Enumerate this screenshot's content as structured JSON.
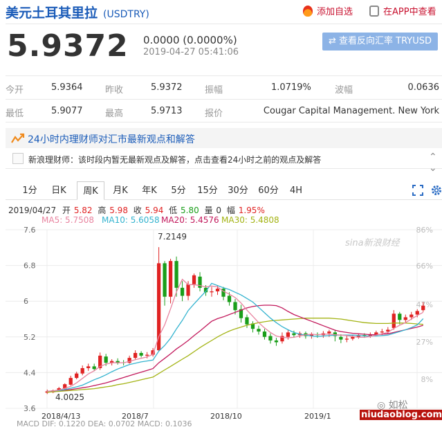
{
  "header": {
    "title": "美元土耳其里拉",
    "code": "(USDTRY)",
    "add_watch": "添加自选",
    "view_in_app": "在APP中查看"
  },
  "quote": {
    "price": "5.9372",
    "change": "0.0000 (0.0000%)",
    "time": "2019-04-27 05:41:06",
    "reverse_btn": "⇄ 查看反向汇率 TRYUSD"
  },
  "stats": [
    [
      {
        "label": "今开",
        "value": "5.9364"
      },
      {
        "label": "昨收",
        "value": "5.9372"
      },
      {
        "label": "振幅",
        "value": "1.0719%"
      },
      {
        "label": "波幅",
        "value": "0.0636"
      }
    ],
    [
      {
        "label": "最低",
        "value": "5.9077"
      },
      {
        "label": "最高",
        "value": "5.9713"
      },
      {
        "label": "报价",
        "value": "Cougar Capital Management. New York"
      }
    ]
  ],
  "expert": {
    "title": "24小时内理财师对汇市最新观点和解答",
    "note": "新浪理财师：该时段内暂无最新观点及解答，点击查看24小时之前的观点及解答"
  },
  "tabs": [
    "1分",
    "日K",
    "周K",
    "月K",
    "年K",
    "5分",
    "15分",
    "30分",
    "60分",
    "4H"
  ],
  "active_tab": "周K",
  "ohlc": {
    "date": "2019/04/27",
    "open_label": "开",
    "open": "5.82",
    "high_label": "高",
    "high": "5.98",
    "close_label": "收",
    "close": "5.94",
    "low_label": "低",
    "low": "5.80",
    "volume_label": "量",
    "volume": "0",
    "amp_label": "幅",
    "amp": "1.95%"
  },
  "ma_legend": [
    {
      "text": "MA5: 5.7508",
      "color": "#e8839f"
    },
    {
      "text": "MA10: 5.6058",
      "color": "#33b3cf"
    },
    {
      "text": "MA20: 5.4576",
      "color": "#c2185b"
    },
    {
      "text": "MA30: 5.4808",
      "color": "#a3b313"
    }
  ],
  "watermark": "sina新浪财经",
  "wechat": "◎ 如松",
  "site": "niudaoblog.com",
  "macd": "MACD   DIF: 0.1220          DEA: 0.0702         MACD: 0.1036",
  "colors": {
    "up": "#e02222",
    "down": "#1a9e1a",
    "ma5": "#e8839f",
    "ma10": "#33b3cf",
    "ma20": "#c2185b",
    "ma30": "#a3b313"
  },
  "chart_data": {
    "type": "candlestick",
    "x_ticks": [
      "2018/4/13",
      "2018/7",
      "2018/10",
      "2019/1",
      "2019/4/27"
    ],
    "y_ticks": [
      "7.6",
      "6.8",
      "6",
      "5.2",
      "4.4",
      "3.6"
    ],
    "pct_ticks": [
      "86%",
      "66%",
      "47%",
      "27%",
      "8%"
    ],
    "ylim": [
      3.6,
      7.6
    ],
    "max_label": "7.2149",
    "min_label": "4.0025",
    "candles": [
      [
        3.95,
        3.98,
        3.92,
        4.02
      ],
      [
        3.96,
        4.0,
        3.94,
        4.02
      ],
      [
        4.0,
        4.05,
        3.99,
        4.08
      ],
      [
        4.04,
        4.14,
        4.02,
        4.16
      ],
      [
        4.13,
        4.28,
        4.11,
        4.33
      ],
      [
        4.28,
        4.38,
        4.25,
        4.42
      ],
      [
        4.38,
        4.5,
        4.34,
        4.56
      ],
      [
        4.5,
        4.54,
        4.44,
        4.6
      ],
      [
        4.54,
        4.48,
        4.44,
        4.6
      ],
      [
        4.5,
        4.78,
        4.46,
        4.85
      ],
      [
        4.76,
        4.62,
        4.55,
        4.82
      ],
      [
        4.62,
        4.66,
        4.56,
        4.7
      ],
      [
        4.66,
        4.62,
        4.58,
        4.72
      ],
      [
        4.63,
        4.62,
        4.56,
        4.68
      ],
      [
        4.62,
        4.73,
        4.6,
        4.78
      ],
      [
        4.73,
        4.84,
        4.7,
        4.9
      ],
      [
        4.84,
        4.78,
        4.74,
        4.88
      ],
      [
        4.78,
        4.8,
        4.72,
        4.86
      ],
      [
        4.8,
        4.9,
        4.76,
        4.95
      ],
      [
        4.9,
        6.85,
        4.88,
        7.21
      ],
      [
        6.85,
        6.1,
        5.9,
        6.9
      ],
      [
        6.1,
        6.9,
        5.95,
        6.95
      ],
      [
        6.9,
        6.3,
        6.1,
        7.0
      ],
      [
        6.3,
        6.12,
        6.0,
        6.45
      ],
      [
        6.12,
        6.38,
        6.02,
        6.45
      ],
      [
        6.38,
        6.58,
        6.3,
        6.62
      ],
      [
        6.55,
        6.3,
        6.22,
        6.65
      ],
      [
        6.3,
        6.2,
        6.12,
        6.36
      ],
      [
        6.2,
        6.22,
        6.1,
        6.32
      ],
      [
        6.22,
        6.28,
        6.14,
        6.36
      ],
      [
        6.28,
        6.1,
        6.02,
        6.32
      ],
      [
        6.12,
        5.98,
        5.9,
        6.2
      ],
      [
        5.98,
        5.8,
        5.7,
        6.05
      ],
      [
        5.82,
        5.62,
        5.52,
        5.92
      ],
      [
        5.64,
        5.48,
        5.4,
        5.7
      ],
      [
        5.5,
        5.38,
        5.3,
        5.55
      ],
      [
        5.38,
        5.32,
        5.25,
        5.45
      ],
      [
        5.32,
        5.2,
        5.14,
        5.38
      ],
      [
        5.22,
        5.12,
        5.05,
        5.28
      ],
      [
        5.12,
        5.08,
        5.0,
        5.18
      ],
      [
        5.1,
        5.22,
        5.05,
        5.3
      ],
      [
        5.2,
        5.3,
        5.14,
        5.35
      ],
      [
        5.28,
        5.24,
        5.18,
        5.34
      ],
      [
        5.24,
        5.28,
        5.18,
        5.32
      ],
      [
        5.28,
        5.22,
        5.16,
        5.32
      ],
      [
        5.22,
        5.26,
        5.16,
        5.3
      ],
      [
        5.26,
        5.24,
        5.18,
        5.3
      ],
      [
        5.24,
        5.28,
        5.18,
        5.33
      ],
      [
        5.28,
        5.32,
        5.2,
        5.36
      ],
      [
        5.3,
        5.22,
        5.1,
        5.36
      ],
      [
        5.2,
        5.14,
        5.06,
        5.26
      ],
      [
        5.14,
        5.16,
        5.08,
        5.22
      ],
      [
        5.16,
        5.2,
        5.12,
        5.24
      ],
      [
        5.2,
        5.24,
        5.16,
        5.28
      ],
      [
        5.24,
        5.22,
        5.18,
        5.28
      ],
      [
        5.22,
        5.26,
        5.18,
        5.3
      ],
      [
        5.26,
        5.3,
        5.22,
        5.34
      ],
      [
        5.3,
        5.32,
        5.24,
        5.38
      ],
      [
        5.32,
        5.36,
        5.26,
        5.42
      ],
      [
        5.4,
        5.72,
        5.36,
        5.8
      ],
      [
        5.72,
        5.58,
        5.48,
        5.76
      ],
      [
        5.58,
        5.64,
        5.52,
        5.7
      ],
      [
        5.64,
        5.7,
        5.58,
        5.76
      ],
      [
        5.7,
        5.78,
        5.64,
        5.82
      ],
      [
        5.8,
        5.9,
        5.76,
        5.98
      ]
    ],
    "ma5": [
      3.98,
      3.99,
      4.01,
      4.05,
      4.09,
      4.17,
      4.27,
      4.37,
      4.44,
      4.54,
      4.59,
      4.62,
      4.62,
      4.62,
      4.65,
      4.69,
      4.72,
      4.75,
      4.81,
      5.21,
      5.47,
      5.83,
      6.21,
      6.49,
      6.37,
      6.37,
      6.35,
      6.32,
      6.34,
      6.32,
      6.22,
      6.16,
      6.08,
      5.96,
      5.8,
      5.66,
      5.52,
      5.4,
      5.3,
      5.22,
      5.19,
      5.18,
      5.19,
      5.22,
      5.25,
      5.26,
      5.25,
      5.26,
      5.26,
      5.25,
      5.24,
      5.23,
      5.21,
      5.19,
      5.19,
      5.21,
      5.24,
      5.27,
      5.3,
      5.39,
      5.46,
      5.52,
      5.6,
      5.68,
      5.75
    ],
    "ma10": [
      3.98,
      3.99,
      4.0,
      4.02,
      4.05,
      4.08,
      4.12,
      4.18,
      4.24,
      4.29,
      4.35,
      4.42,
      4.48,
      4.53,
      4.58,
      4.61,
      4.64,
      4.66,
      4.68,
      4.88,
      5.01,
      5.17,
      5.38,
      5.57,
      5.79,
      5.94,
      6.08,
      6.22,
      6.4,
      6.35,
      6.3,
      6.26,
      6.2,
      6.14,
      6.06,
      5.98,
      5.86,
      5.74,
      5.62,
      5.52,
      5.43,
      5.36,
      5.3,
      5.26,
      5.24,
      5.22,
      5.21,
      5.22,
      5.23,
      5.24,
      5.24,
      5.24,
      5.24,
      5.23,
      5.22,
      5.22,
      5.22,
      5.23,
      5.24,
      5.28,
      5.32,
      5.36,
      5.41,
      5.47,
      5.61
    ],
    "ma20": [
      3.98,
      3.99,
      4.0,
      4.01,
      4.02,
      4.04,
      4.06,
      4.08,
      4.11,
      4.14,
      4.17,
      4.21,
      4.25,
      4.29,
      4.33,
      4.37,
      4.41,
      4.45,
      4.49,
      4.62,
      4.72,
      4.82,
      4.93,
      5.02,
      5.12,
      5.23,
      5.33,
      5.44,
      5.55,
      5.61,
      5.65,
      5.7,
      5.75,
      5.8,
      5.85,
      5.88,
      5.9,
      5.91,
      5.91,
      5.9,
      5.85,
      5.77,
      5.7,
      5.65,
      5.6,
      5.55,
      5.5,
      5.45,
      5.4,
      5.35,
      5.32,
      5.3,
      5.28,
      5.27,
      5.26,
      5.25,
      5.25,
      5.26,
      5.27,
      5.3,
      5.33,
      5.36,
      5.39,
      5.42,
      5.46
    ],
    "ma30": [
      3.96,
      3.97,
      3.98,
      3.99,
      4.0,
      4.01,
      4.02,
      4.03,
      4.04,
      4.06,
      4.08,
      4.1,
      4.13,
      4.15,
      4.18,
      4.21,
      4.24,
      4.27,
      4.3,
      4.38,
      4.46,
      4.54,
      4.62,
      4.7,
      4.78,
      4.87,
      4.96,
      5.04,
      5.12,
      5.2,
      5.27,
      5.33,
      5.38,
      5.42,
      5.46,
      5.49,
      5.52,
      5.54,
      5.56,
      5.57,
      5.58,
      5.59,
      5.6,
      5.61,
      5.62,
      5.62,
      5.62,
      5.62,
      5.62,
      5.61,
      5.6,
      5.58,
      5.56,
      5.54,
      5.52,
      5.51,
      5.5,
      5.5,
      5.5,
      5.51,
      5.51,
      5.51,
      5.5,
      5.49,
      5.48
    ]
  }
}
